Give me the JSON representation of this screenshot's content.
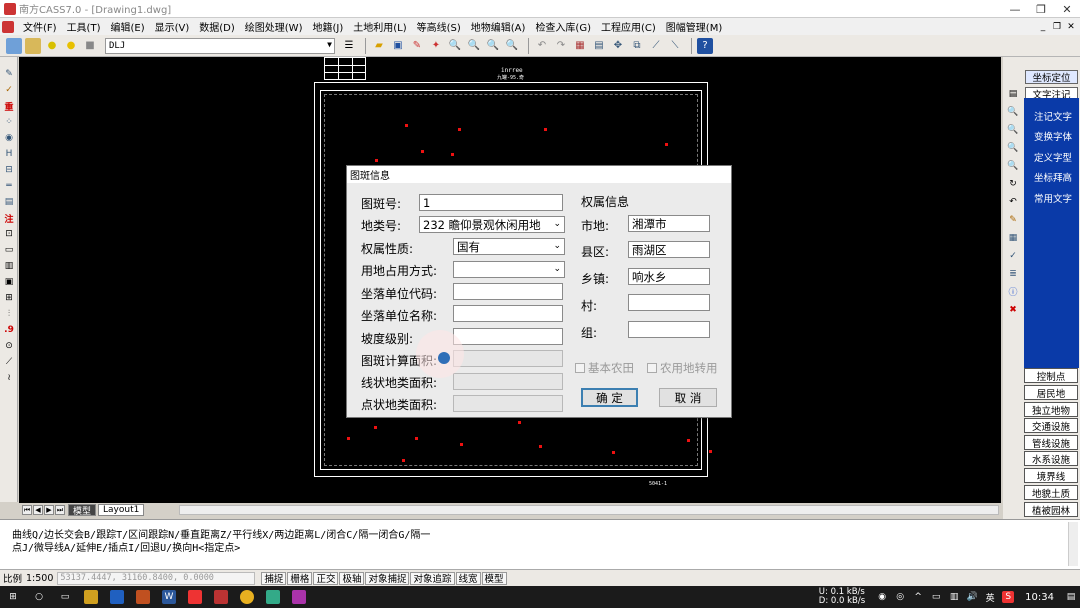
{
  "window": {
    "title": "南方CASS7.0 - [Drawing1.dwg]"
  },
  "menu": {
    "items": [
      "文件(F)",
      "工具(T)",
      "编辑(E)",
      "显示(V)",
      "数据(D)",
      "绘图处理(W)",
      "地籍(J)",
      "土地利用(L)",
      "等高线(S)",
      "地物编辑(A)",
      "检查入库(G)",
      "工程应用(C)",
      "图幅管理(M)"
    ]
  },
  "toolbar": {
    "layer_name": "DLJ"
  },
  "canvas": {
    "title_text": "inrree",
    "subtitle_text": "九罐-95.奇",
    "legend_text": "5041-1"
  },
  "tabs": {
    "model": "模型",
    "layout": "Layout1"
  },
  "right_panel": {
    "top_buttons": [
      "坐标定位",
      "文字注记"
    ],
    "blue_items": [
      "注记文字",
      "变换字体",
      "定义字型",
      "坐标拜高",
      "常用文字"
    ],
    "bottom_buttons": [
      "控制点",
      "居民地",
      "独立地物",
      "交通设施",
      "管线设施",
      "水系设施",
      "境界线",
      "地貌土质",
      "植被园林"
    ]
  },
  "command": {
    "line1": "曲线Q/边长交会B/跟踪T/区间跟踪N/垂直距离Z/平行线X/两边距离L/闭合C/隔一闭合G/隔一",
    "line2": "点J/微导线A/延伸E/插点I/回退U/换向H<指定点>"
  },
  "status": {
    "scale_label": "比例",
    "scale_value": "1:500",
    "coords": "53137.4447, 31160.8400, 0.0000",
    "buttons": [
      "捕捉",
      "栅格",
      "正交",
      "极轴",
      "对象捕捉",
      "对象追踪",
      "线宽",
      "模型"
    ]
  },
  "taskbar": {
    "net_up": "0.1 kB/s",
    "net_down": "0.0 kB/s",
    "net_up_label": "U:",
    "net_down_label": "D:",
    "ime": "英",
    "time": "10:34"
  },
  "dialog": {
    "title": "图斑信息",
    "fields": {
      "patch_no": {
        "label": "图斑号:",
        "value": "1"
      },
      "land_class": {
        "label": "地类号:",
        "value": "232 瞻仰景观休闲用地"
      },
      "ownership": {
        "label": "权属性质:",
        "value": "国有"
      },
      "occupation": {
        "label": "用地占用方式:",
        "value": ""
      },
      "unit_code": {
        "label": "坐落单位代码:",
        "value": ""
      },
      "unit_name": {
        "label": "坐落单位名称:",
        "value": ""
      },
      "slope": {
        "label": "坡度级别:",
        "value": ""
      },
      "calc_area": {
        "label": "图斑计算面积:",
        "value": ""
      },
      "line_area": {
        "label": "线状地类面积:",
        "value": ""
      },
      "point_area": {
        "label": "点状地类面积:",
        "value": ""
      }
    },
    "ownership_info": {
      "heading": "权属信息",
      "city": {
        "label": "市地:",
        "value": "湘潭市"
      },
      "county": {
        "label": "县区:",
        "value": "雨湖区"
      },
      "town": {
        "label": "乡镇:",
        "value": "响水乡"
      },
      "village": {
        "label": "村:",
        "value": ""
      },
      "group": {
        "label": "组:",
        "value": ""
      }
    },
    "checks": {
      "basic_farmland": "基本农田",
      "farm_convert": "农用地转用"
    },
    "ok_label": "确 定",
    "cancel_label": "取 消"
  },
  "colors": {
    "canvas_bg": "#000000",
    "accent_blue": "#0a3aa8",
    "red_points": "#e11111"
  }
}
